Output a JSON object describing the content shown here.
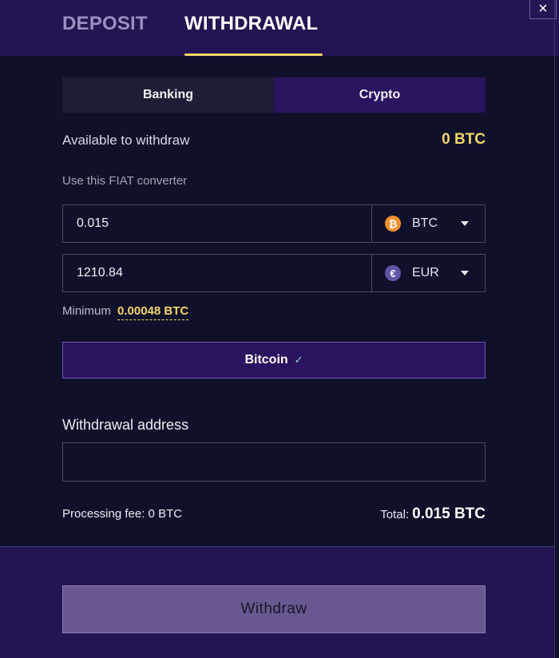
{
  "tabs": {
    "deposit": "DEPOSIT",
    "withdrawal": "WITHDRAWAL",
    "active": "withdrawal"
  },
  "close": {
    "glyph": "×",
    "icon": "close-icon"
  },
  "method_tabs": {
    "banking": "Banking",
    "crypto": "Crypto",
    "active": "crypto"
  },
  "available": {
    "label": "Available to withdraw",
    "value": "0 BTC"
  },
  "converter": {
    "label": "Use this FIAT converter",
    "crypto_amount": "0.015",
    "crypto_currency": "BTC",
    "crypto_icon": "bitcoin-icon",
    "crypto_icon_glyph": "₿",
    "fiat_amount": "1210.84",
    "fiat_currency": "EUR",
    "fiat_icon": "euro-icon",
    "fiat_icon_glyph": "€"
  },
  "minimum": {
    "label": "Minimum",
    "value": "0.00048 BTC"
  },
  "network_button": {
    "label": "Bitcoin",
    "check": "✓"
  },
  "address": {
    "label": "Withdrawal address",
    "value": "",
    "placeholder": ""
  },
  "processing_fee": "Processing fee: 0 BTC",
  "total": {
    "label": "Total:",
    "value": "0.015 BTC"
  },
  "withdraw_button": "Withdraw",
  "colors": {
    "background": "#0f1029",
    "header": "#241451",
    "accent_yellow": "#f5d66b",
    "active_tab": "#2a135f",
    "withdraw_button": "#68588f"
  }
}
